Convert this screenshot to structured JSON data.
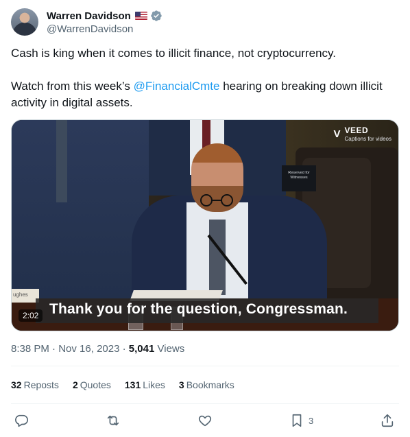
{
  "author": {
    "display_name": "Warren Davidson",
    "handle": "@WarrenDavidson",
    "flag_icon": "us-flag-icon",
    "verified_icon": "verified-badge-icon",
    "verified_color": "#829aab"
  },
  "tweet": {
    "line1": "Cash is king when it comes to illicit finance, not cryptocurrency.",
    "line2_before": "Watch from this week’s ",
    "mention": "@FinancialCmte",
    "line2_after": " hearing on breaking down illicit activity in digital assets."
  },
  "media": {
    "caption": "Thank you for the question, Congressman.",
    "duration": "2:02",
    "watermark_brand": "VEED",
    "watermark_tagline": "Captions for videos",
    "watermark_logo": "V",
    "placard_text": "Reserved for Witnesses",
    "nameplate_text": "ughes"
  },
  "meta": {
    "time": "8:38 PM",
    "separator": "·",
    "date": "Nov 16, 2023",
    "views_count": "5,041",
    "views_label": "Views"
  },
  "stats": [
    {
      "count": "32",
      "label": "Reposts"
    },
    {
      "count": "2",
      "label": "Quotes"
    },
    {
      "count": "131",
      "label": "Likes"
    },
    {
      "count": "3",
      "label": "Bookmarks"
    }
  ],
  "actions": {
    "reply_icon": "reply-icon",
    "repost_icon": "repost-icon",
    "like_icon": "like-icon",
    "bookmark_icon": "bookmark-icon",
    "bookmark_count": "3",
    "share_icon": "share-icon"
  },
  "colors": {
    "accent": "#1d9bf0",
    "text_primary": "#0f1419",
    "text_secondary": "#536471"
  }
}
